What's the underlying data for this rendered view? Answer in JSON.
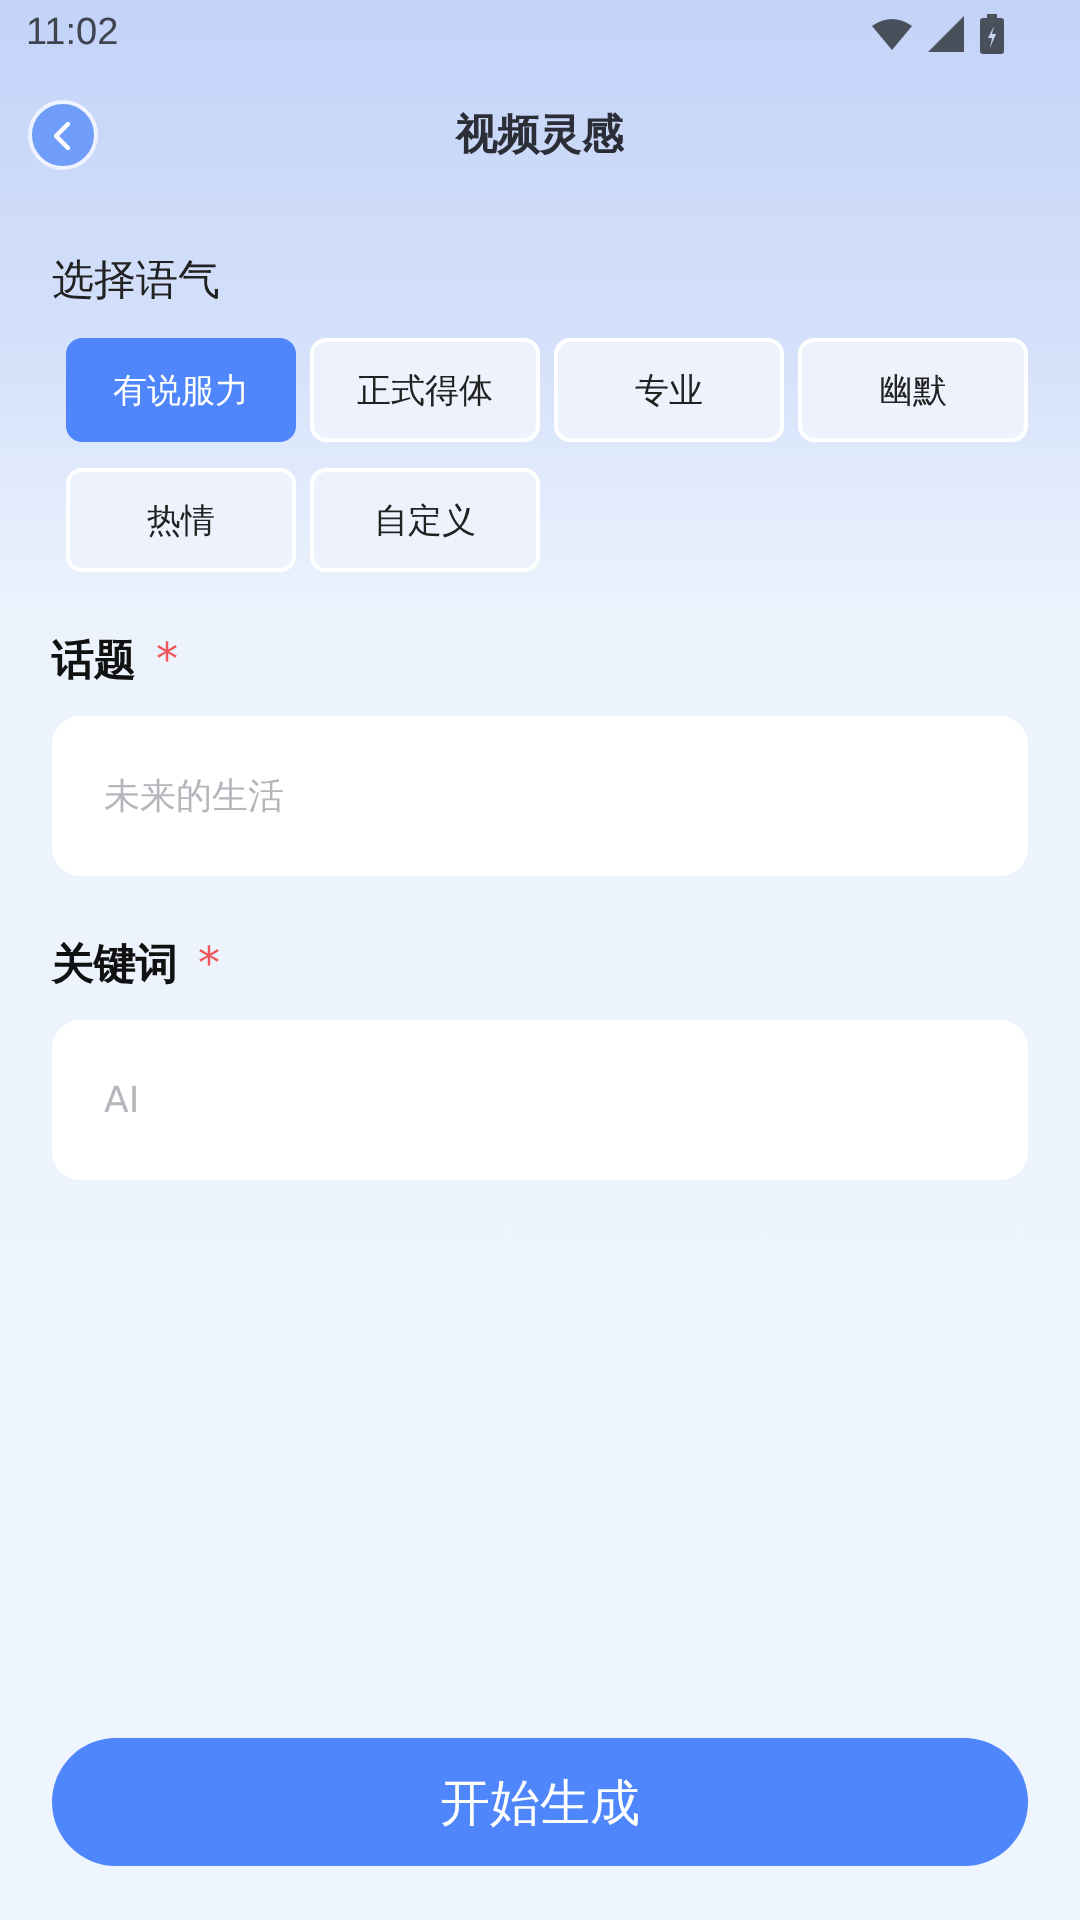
{
  "status_bar": {
    "time": "11:02"
  },
  "header": {
    "title": "视频灵感"
  },
  "tone": {
    "label": "选择语气",
    "options": [
      {
        "label": "有说服力",
        "selected": true
      },
      {
        "label": "正式得体",
        "selected": false
      },
      {
        "label": "专业",
        "selected": false
      },
      {
        "label": "幽默",
        "selected": false
      },
      {
        "label": "热情",
        "selected": false
      },
      {
        "label": "自定义",
        "selected": false
      }
    ]
  },
  "fields": [
    {
      "label": "话题",
      "required_mark": "*",
      "placeholder": "未来的生活"
    },
    {
      "label": "关键词",
      "required_mark": "*",
      "placeholder": "AI"
    }
  ],
  "submit_button": "开始生成"
}
